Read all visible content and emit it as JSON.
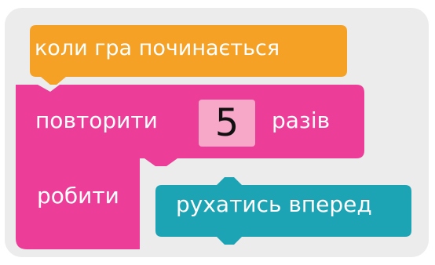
{
  "blocks": {
    "event": {
      "label": "коли гра починається",
      "color": "#f5a126"
    },
    "repeat": {
      "label_before": "повторити",
      "count": "5",
      "label_after": "разів",
      "body_label": "робити",
      "color": "#ec3d98",
      "input_color": "#f7a7c8"
    },
    "action": {
      "label": "рухатись вперед",
      "color": "#1ca4b5"
    }
  },
  "canvas": {
    "background": "#ececec"
  }
}
